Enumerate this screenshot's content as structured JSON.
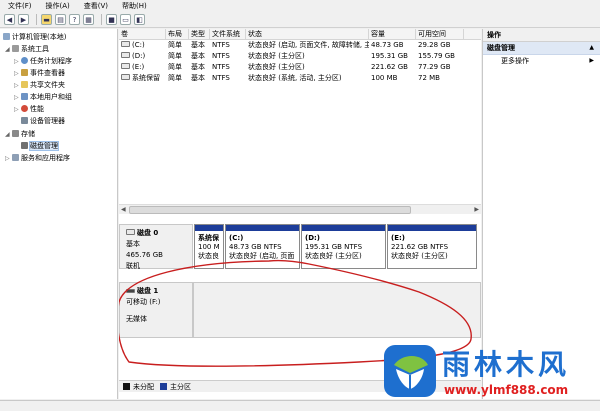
{
  "menu": [
    "文件(F)",
    "操作(A)",
    "查看(V)",
    "帮助(H)"
  ],
  "tree": {
    "root": "计算机管理(本地)",
    "system_tools": "系统工具",
    "task_scheduler": "任务计划程序",
    "event_viewer": "事件查看器",
    "shared_folders": "共享文件夹",
    "local_users": "本地用户和组",
    "performance": "性能",
    "device_manager": "设备管理器",
    "storage": "存储",
    "disk_management": "磁盘管理",
    "services_apps": "服务和应用程序"
  },
  "table": {
    "headers": [
      "卷",
      "布局",
      "类型",
      "文件系统",
      "状态",
      "容量",
      "可用空间"
    ],
    "rows": [
      [
        "(C:)",
        "简单",
        "基本",
        "NTFS",
        "状态良好 (启动, 页面文件, 故障转储, 主分区)",
        "48.73 GB",
        "29.28 GB"
      ],
      [
        "(D:)",
        "简单",
        "基本",
        "NTFS",
        "状态良好 (主分区)",
        "195.31 GB",
        "155.79 GB"
      ],
      [
        "(E:)",
        "简单",
        "基本",
        "NTFS",
        "状态良好 (主分区)",
        "221.62 GB",
        "77.29 GB"
      ],
      [
        "系统保留",
        "简单",
        "基本",
        "NTFS",
        "状态良好 (系统, 活动, 主分区)",
        "100 MB",
        "72 MB"
      ]
    ]
  },
  "disk0": {
    "name": "磁盘 0",
    "type": "基本",
    "size": "465.76 GB",
    "status": "联机",
    "partitions": [
      {
        "name": "系统保",
        "size": "100 M",
        "status": "状态良"
      },
      {
        "name": "(C:)",
        "size": "48.73 GB NTFS",
        "status": "状态良好 (启动, 页面"
      },
      {
        "name": "(D:)",
        "size": "195.31 GB NTFS",
        "status": "状态良好 (主分区)"
      },
      {
        "name": "(E:)",
        "size": "221.62 GB NTFS",
        "status": "状态良好 (主分区)"
      }
    ]
  },
  "disk1": {
    "name": "磁盘 1",
    "type": "可移动 (F:)",
    "status": "无媒体"
  },
  "legend": {
    "unallocated": "未分配",
    "primary": "主分区"
  },
  "actions": {
    "title": "操作",
    "section": "磁盘管理",
    "more": "更多操作"
  },
  "watermark": {
    "brand": "雨林木风",
    "url": "www.ylmf888.com"
  },
  "colors": {
    "primary_partition": "#1d3d99",
    "unallocated": "#111111",
    "selection": "#d9e6f7",
    "annotation_red": "#c81e1e",
    "brand_blue": "#1e6fcf"
  }
}
